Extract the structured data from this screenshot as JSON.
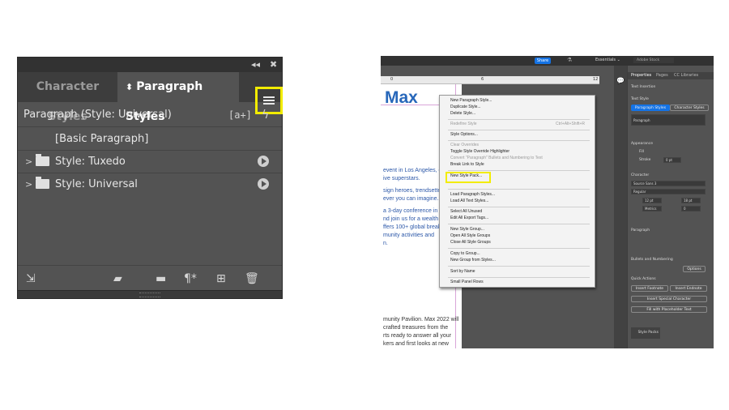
{
  "left_panel": {
    "tabs": {
      "character": "Character Styles",
      "paragraph": "Paragraph Styles"
    },
    "header": {
      "label": "Paragraph (Style: Universal)",
      "bracket_icon": "[a+]",
      "bolt_icon": "ϟ"
    },
    "rows": [
      {
        "label": "[Basic Paragraph]"
      },
      {
        "label": "Style: Tuxedo"
      },
      {
        "label": "Style: Universal"
      }
    ]
  },
  "right_shot": {
    "topbar": {
      "share": "Share",
      "workspace": "Essentials ⌄",
      "search_placeholder": "Adobe Stock"
    },
    "ruler_ticks": [
      "0",
      "6",
      "12"
    ],
    "doc": {
      "title": "Max",
      "lines1": [
        "event in Los Angeles, o",
        "ive superstars.",
        "sign heroes, trendsette",
        "ever you can imagine.",
        "a 3-day conference in Lo",
        "nd join us for a wealth o",
        "ffers 100+ global breako",
        "munity activities and",
        "n."
      ],
      "lines2": [
        "munity Pavilion. Max 2022 will",
        "crafted treasures from the",
        "rts ready to answer all your",
        "kers and first looks at new"
      ]
    },
    "context_menu": {
      "items": [
        {
          "label": "New Paragraph Style...",
          "disabled": false
        },
        {
          "label": "Duplicate Style...",
          "disabled": false
        },
        {
          "label": "Delete Style...",
          "disabled": false
        },
        {
          "label": "Redefine Style",
          "disabled": true,
          "shortcut": "Ctrl+Alt+Shift+R"
        },
        {
          "label": "Style Options...",
          "disabled": false
        },
        {
          "label": "Clear Overrides",
          "disabled": true
        },
        {
          "label": "Toggle Style Override Highlighter",
          "disabled": false
        },
        {
          "label": "Convert \"Paragraph\" Bullets and Numbering to Text",
          "disabled": true
        },
        {
          "label": "Break Link to Style",
          "disabled": false
        },
        {
          "label": "New Style Pack...",
          "disabled": false
        },
        {
          "label": "Load Paragraph Styles...",
          "disabled": false
        },
        {
          "label": "Load All Text Styles...",
          "disabled": false
        },
        {
          "label": "Select All Unused",
          "disabled": false
        },
        {
          "label": "Edit All Export Tags...",
          "disabled": false
        },
        {
          "label": "New Style Group...",
          "disabled": false
        },
        {
          "label": "Open All Style Groups",
          "disabled": false
        },
        {
          "label": "Close All Style Groups",
          "disabled": false
        },
        {
          "label": "Copy to Group...",
          "disabled": false
        },
        {
          "label": "New Group from Styles...",
          "disabled": false
        },
        {
          "label": "Sort by Name",
          "disabled": false
        },
        {
          "label": "Small Panel Rows",
          "disabled": false
        }
      ]
    },
    "properties": {
      "tabs": [
        "Properties",
        "Pages",
        "CC Libraries"
      ],
      "text_insertion": "Text Insertion",
      "text_style": "Text Style",
      "para_styles_btn": "Paragraph Styles",
      "char_styles_btn": "Character Styles",
      "para_field": "Paragraph",
      "appearance": "Appearance",
      "fill": "Fill",
      "stroke": "Stroke",
      "stroke_val": "0 pt",
      "character": "Character",
      "font": "Source Sans 3",
      "weight": "Regular",
      "size": "12 pt",
      "leading": "18 pt",
      "kerning": "Metrics",
      "tracking": "0",
      "paragraph": "Paragraph",
      "bullets": "Bullets and Numbering",
      "options": "Options",
      "quick_actions": "Quick Actions",
      "insert_footnote": "Insert Footnote",
      "insert_endnote": "Insert Endnote",
      "insert_special": "Insert Special Character",
      "fill_placeholder": "Fill with Placeholder Text",
      "style_packs": "Style Packs"
    },
    "highlight_color": "#f2ec00"
  }
}
